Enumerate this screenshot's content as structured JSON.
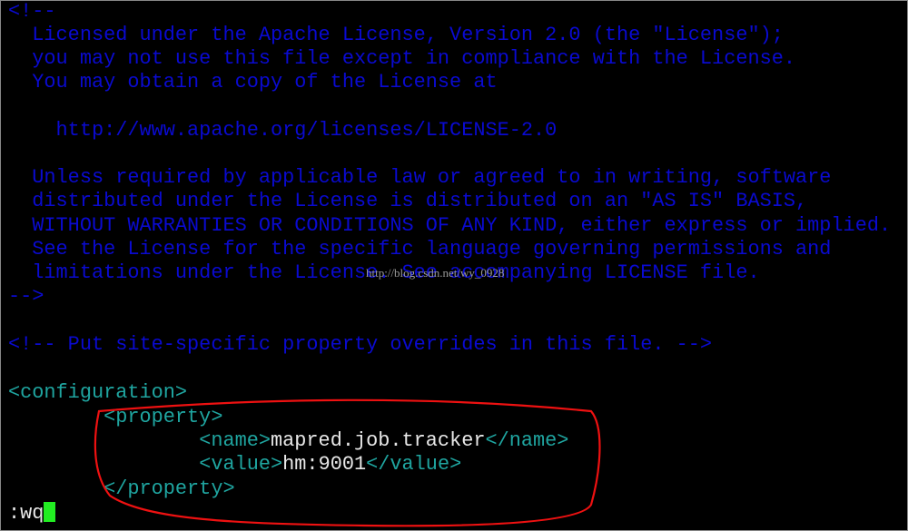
{
  "editor": {
    "comment_lines": [
      "<!--",
      "  Licensed under the Apache License, Version 2.0 (the \"License\");",
      "  you may not use this file except in compliance with the License.",
      "  You may obtain a copy of the License at",
      "",
      "    http://www.apache.org/licenses/LICENSE-2.0",
      "",
      "  Unless required by applicable law or agreed to in writing, software",
      "  distributed under the License is distributed on an \"AS IS\" BASIS,",
      "  WITHOUT WARRANTIES OR CONDITIONS OF ANY KIND, either express or implied.",
      "  See the License for the specific language governing permissions and",
      "  limitations under the License. See accompanying LICENSE file.",
      "-->",
      "",
      "<!-- Put site-specific property overrides in this file. -->"
    ],
    "configuration_open": "<configuration>",
    "property_open": "        <property>",
    "name_indent": "                ",
    "name_open": "<name>",
    "name_value": "mapred.job.tracker",
    "name_close": "</name>",
    "value_open": "<value>",
    "value_value": "hm:9001",
    "value_close": "</value>",
    "property_close": "        </property>",
    "command_line": ":wq"
  },
  "watermark": "http://blog.csdn.net/wy_0928",
  "colors": {
    "comment": "#0a0ad0",
    "tag": "#1fa5a0",
    "text": "#e8e8e8",
    "cursor": "#22ee22",
    "annotation": "#ee1111"
  }
}
